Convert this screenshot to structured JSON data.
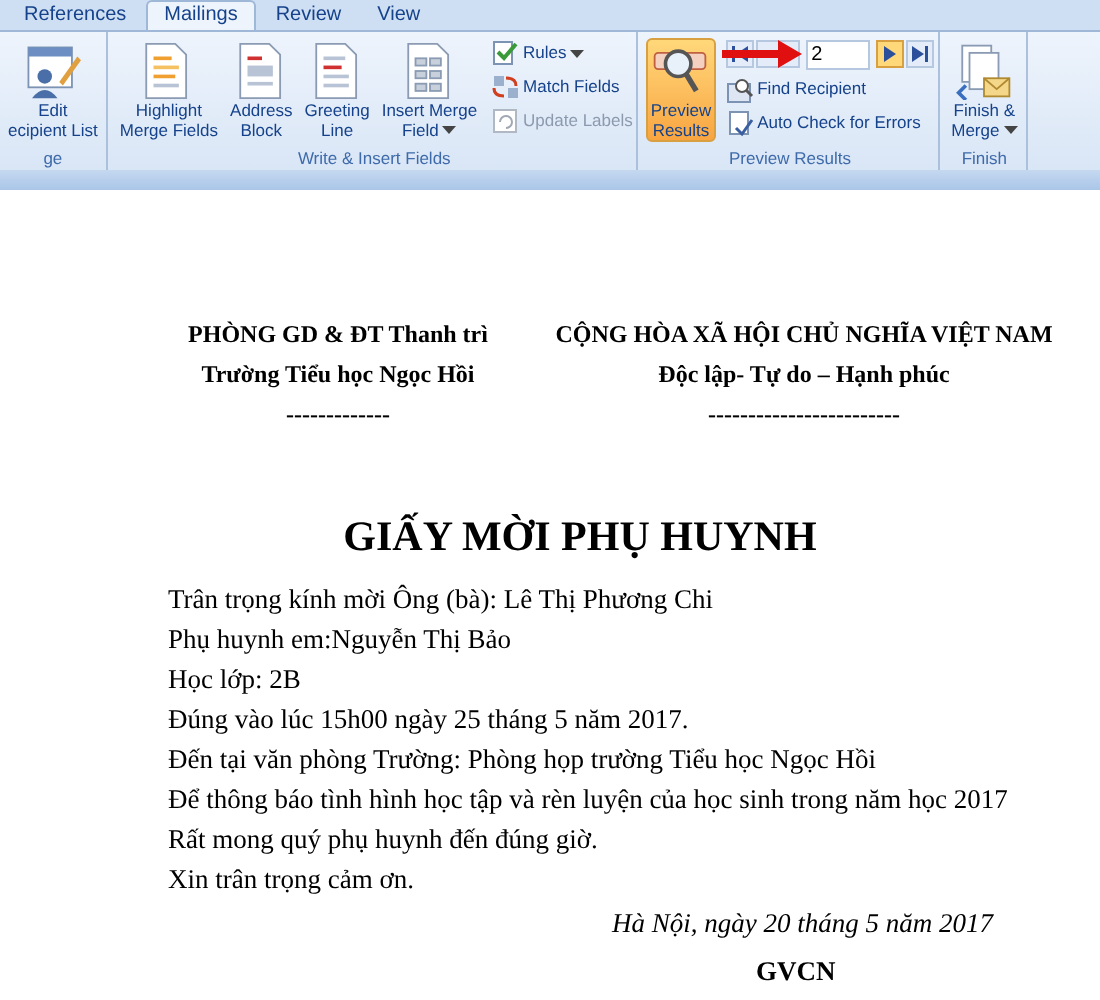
{
  "tabs": [
    {
      "label": "References",
      "selected": false
    },
    {
      "label": "Mailings",
      "selected": true
    },
    {
      "label": "Review",
      "selected": false
    },
    {
      "label": "View",
      "selected": false
    }
  ],
  "ribbon": {
    "groups": [
      {
        "label": "ge",
        "items": [
          {
            "kind": "large",
            "lines": [
              "Edit",
              "ecipient List"
            ],
            "selected": false,
            "dropdown": false
          }
        ]
      },
      {
        "label": "Write & Insert Fields",
        "items": [
          {
            "kind": "large",
            "lines": [
              "Highlight",
              "Merge Fields"
            ],
            "selected": false,
            "dropdown": false
          },
          {
            "kind": "large",
            "lines": [
              "Address",
              "Block"
            ],
            "selected": false,
            "dropdown": false
          },
          {
            "kind": "large",
            "lines": [
              "Greeting",
              "Line"
            ],
            "selected": false,
            "dropdown": false
          },
          {
            "kind": "large",
            "lines": [
              "Insert Merge",
              "Field"
            ],
            "selected": false,
            "dropdown": true
          },
          {
            "kind": "stack",
            "items": [
              {
                "kind": "small",
                "label": "Rules",
                "disabled": false,
                "dropdown": true
              },
              {
                "kind": "small",
                "label": "Match Fields",
                "disabled": false,
                "dropdown": false
              },
              {
                "kind": "small",
                "label": "Update Labels",
                "disabled": true,
                "dropdown": false
              }
            ]
          }
        ]
      },
      {
        "label": "Preview Results",
        "items": [
          {
            "kind": "large",
            "lines": [
              "Preview",
              "Results"
            ],
            "selected": true,
            "dropdown": false
          },
          {
            "kind": "stack",
            "items": [
              {
                "kind": "nav",
                "value": "2"
              },
              {
                "kind": "small",
                "label": "Find Recipient",
                "disabled": false,
                "dropdown": false
              },
              {
                "kind": "small",
                "label": "Auto Check for Errors",
                "disabled": false,
                "dropdown": false
              }
            ]
          }
        ]
      },
      {
        "label": "Finish",
        "items": [
          {
            "kind": "large",
            "lines": [
              "Finish &",
              "Merge"
            ],
            "selected": false,
            "dropdown": true
          }
        ]
      }
    ]
  },
  "document": {
    "header_left": [
      "PHÒNG GD & ĐT Thanh trì",
      "Trường Tiểu học Ngọc Hồi",
      "-------------"
    ],
    "header_right": [
      "CỘNG HÒA XÃ HỘI CHỦ NGHĨA VIỆT NAM",
      "Độc lập- Tự do – Hạnh phúc",
      "------------------------"
    ],
    "title": "GIẤY MỜI PHỤ HUYNH",
    "body": [
      "Trân trọng kính mời Ông (bà): Lê Thị Phương Chi",
      "Phụ huynh em:Nguyễn Thị Bảo",
      "Học lớp: 2B",
      "Đúng vào lúc 15h00 ngày 25 tháng 5 năm 2017.",
      "Đến tại văn phòng Trường: Phòng họp trường Tiểu học Ngọc Hồi",
      "Để thông báo tình hình học tập và rèn luyện của học sinh trong năm học 2017",
      "Rất mong quý phụ huynh đến đúng giờ.",
      "Xin trân trọng cảm ơn."
    ],
    "date": "Hà Nội, ngày 20 tháng 5  năm 2017",
    "signature": "GVCN"
  }
}
